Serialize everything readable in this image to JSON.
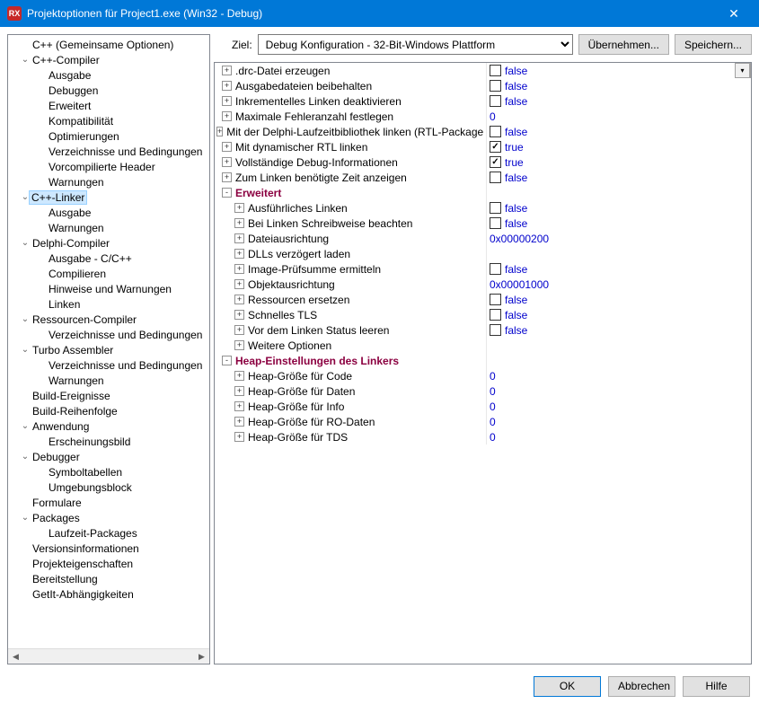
{
  "window": {
    "title": "Projektoptionen für Project1.exe  (Win32 - Debug)",
    "icon_text": "RX"
  },
  "target": {
    "label": "Ziel:",
    "value": "Debug Konfiguration - 32-Bit-Windows Plattform",
    "apply_btn": "Übernehmen...",
    "save_btn": "Speichern..."
  },
  "tree": [
    {
      "label": "C++ (Gemeinsame Optionen)",
      "depth": 0,
      "toggle": "leaf"
    },
    {
      "label": "C++-Compiler",
      "depth": 0,
      "toggle": "open"
    },
    {
      "label": "Ausgabe",
      "depth": 1,
      "toggle": "leaf"
    },
    {
      "label": "Debuggen",
      "depth": 1,
      "toggle": "leaf"
    },
    {
      "label": "Erweitert",
      "depth": 1,
      "toggle": "leaf"
    },
    {
      "label": "Kompatibilität",
      "depth": 1,
      "toggle": "leaf"
    },
    {
      "label": "Optimierungen",
      "depth": 1,
      "toggle": "leaf"
    },
    {
      "label": "Verzeichnisse und Bedingungen",
      "depth": 1,
      "toggle": "leaf"
    },
    {
      "label": "Vorcompilierte Header",
      "depth": 1,
      "toggle": "leaf"
    },
    {
      "label": "Warnungen",
      "depth": 1,
      "toggle": "leaf"
    },
    {
      "label": "C++-Linker",
      "depth": 0,
      "toggle": "open",
      "selected": true
    },
    {
      "label": "Ausgabe",
      "depth": 1,
      "toggle": "leaf"
    },
    {
      "label": "Warnungen",
      "depth": 1,
      "toggle": "leaf"
    },
    {
      "label": "Delphi-Compiler",
      "depth": 0,
      "toggle": "open"
    },
    {
      "label": "Ausgabe - C/C++",
      "depth": 1,
      "toggle": "leaf"
    },
    {
      "label": "Compilieren",
      "depth": 1,
      "toggle": "leaf"
    },
    {
      "label": "Hinweise und Warnungen",
      "depth": 1,
      "toggle": "leaf"
    },
    {
      "label": "Linken",
      "depth": 1,
      "toggle": "leaf"
    },
    {
      "label": "Ressourcen-Compiler",
      "depth": 0,
      "toggle": "open"
    },
    {
      "label": "Verzeichnisse und Bedingungen",
      "depth": 1,
      "toggle": "leaf"
    },
    {
      "label": "Turbo Assembler",
      "depth": 0,
      "toggle": "open"
    },
    {
      "label": "Verzeichnisse und Bedingungen",
      "depth": 1,
      "toggle": "leaf"
    },
    {
      "label": "Warnungen",
      "depth": 1,
      "toggle": "leaf"
    },
    {
      "label": "Build-Ereignisse",
      "depth": 0,
      "toggle": "leaf"
    },
    {
      "label": "Build-Reihenfolge",
      "depth": 0,
      "toggle": "leaf"
    },
    {
      "label": "Anwendung",
      "depth": 0,
      "toggle": "open"
    },
    {
      "label": "Erscheinungsbild",
      "depth": 1,
      "toggle": "leaf"
    },
    {
      "label": "Debugger",
      "depth": 0,
      "toggle": "open"
    },
    {
      "label": "Symboltabellen",
      "depth": 1,
      "toggle": "leaf"
    },
    {
      "label": "Umgebungsblock",
      "depth": 1,
      "toggle": "leaf"
    },
    {
      "label": "Formulare",
      "depth": 0,
      "toggle": "leaf"
    },
    {
      "label": "Packages",
      "depth": 0,
      "toggle": "open"
    },
    {
      "label": "Laufzeit-Packages",
      "depth": 1,
      "toggle": "leaf"
    },
    {
      "label": "Versionsinformationen",
      "depth": 0,
      "toggle": "leaf"
    },
    {
      "label": "Projekteigenschaften",
      "depth": 0,
      "toggle": "leaf"
    },
    {
      "label": "Bereitstellung",
      "depth": 0,
      "toggle": "leaf"
    },
    {
      "label": "GetIt-Abhängigkeiten",
      "depth": 0,
      "toggle": "leaf"
    }
  ],
  "grid": [
    {
      "type": "prop",
      "depth": 0,
      "expand": "+",
      "name": ".drc-Datei erzeugen",
      "val_type": "chk",
      "checked": false,
      "value": "false",
      "first": true
    },
    {
      "type": "prop",
      "depth": 0,
      "expand": "+",
      "name": "Ausgabedateien beibehalten",
      "val_type": "chk",
      "checked": false,
      "value": "false"
    },
    {
      "type": "prop",
      "depth": 0,
      "expand": "+",
      "name": "Inkrementelles Linken deaktivieren",
      "val_type": "chk",
      "checked": false,
      "value": "false"
    },
    {
      "type": "prop",
      "depth": 0,
      "expand": "+",
      "name": "Maximale Fehleranzahl festlegen",
      "val_type": "text",
      "value": "0"
    },
    {
      "type": "prop",
      "depth": 0,
      "expand": "+",
      "name": "Mit der Delphi-Laufzeitbibliothek linken (RTL-Package u",
      "val_type": "chk",
      "checked": false,
      "value": "false"
    },
    {
      "type": "prop",
      "depth": 0,
      "expand": "+",
      "name": "Mit dynamischer RTL linken",
      "val_type": "chk",
      "checked": true,
      "value": "true"
    },
    {
      "type": "prop",
      "depth": 0,
      "expand": "+",
      "name": "Vollständige Debug-Informationen",
      "val_type": "chk",
      "checked": true,
      "value": "true"
    },
    {
      "type": "prop",
      "depth": 0,
      "expand": "+",
      "name": "Zum Linken benötigte Zeit anzeigen",
      "val_type": "chk",
      "checked": false,
      "value": "false"
    },
    {
      "type": "section",
      "depth": 0,
      "expand": "-",
      "name": "Erweitert"
    },
    {
      "type": "prop",
      "depth": 1,
      "expand": "+",
      "name": "Ausführliches Linken",
      "val_type": "chk",
      "checked": false,
      "value": "false"
    },
    {
      "type": "prop",
      "depth": 1,
      "expand": "+",
      "name": "Bei Linken Schreibweise beachten",
      "val_type": "chk",
      "checked": false,
      "value": "false"
    },
    {
      "type": "prop",
      "depth": 1,
      "expand": "+",
      "name": "Dateiausrichtung",
      "val_type": "text",
      "value": "0x00000200"
    },
    {
      "type": "prop",
      "depth": 1,
      "expand": "+",
      "name": "DLLs verzögert laden",
      "val_type": "text",
      "value": ""
    },
    {
      "type": "prop",
      "depth": 1,
      "expand": "+",
      "name": "Image-Prüfsumme ermitteln",
      "val_type": "chk",
      "checked": false,
      "value": "false"
    },
    {
      "type": "prop",
      "depth": 1,
      "expand": "+",
      "name": "Objektausrichtung",
      "val_type": "text",
      "value": "0x00001000"
    },
    {
      "type": "prop",
      "depth": 1,
      "expand": "+",
      "name": "Ressourcen ersetzen",
      "val_type": "chk",
      "checked": false,
      "value": "false"
    },
    {
      "type": "prop",
      "depth": 1,
      "expand": "+",
      "name": "Schnelles TLS",
      "val_type": "chk",
      "checked": false,
      "value": "false"
    },
    {
      "type": "prop",
      "depth": 1,
      "expand": "+",
      "name": "Vor dem Linken Status leeren",
      "val_type": "chk",
      "checked": false,
      "value": "false"
    },
    {
      "type": "prop",
      "depth": 1,
      "expand": "+",
      "name": "Weitere Optionen",
      "val_type": "text",
      "value": ""
    },
    {
      "type": "section",
      "depth": 0,
      "expand": "-",
      "name": "Heap-Einstellungen des Linkers"
    },
    {
      "type": "prop",
      "depth": 1,
      "expand": "+",
      "name": "Heap-Größe für Code",
      "val_type": "text",
      "value": "0"
    },
    {
      "type": "prop",
      "depth": 1,
      "expand": "+",
      "name": "Heap-Größe für Daten",
      "val_type": "text",
      "value": "0"
    },
    {
      "type": "prop",
      "depth": 1,
      "expand": "+",
      "name": "Heap-Größe für Info",
      "val_type": "text",
      "value": "0"
    },
    {
      "type": "prop",
      "depth": 1,
      "expand": "+",
      "name": "Heap-Größe für RO-Daten",
      "val_type": "text",
      "value": "0"
    },
    {
      "type": "prop",
      "depth": 1,
      "expand": "+",
      "name": "Heap-Größe für TDS",
      "val_type": "text",
      "value": "0"
    }
  ],
  "buttons": {
    "ok": "OK",
    "cancel": "Abbrechen",
    "help": "Hilfe"
  }
}
